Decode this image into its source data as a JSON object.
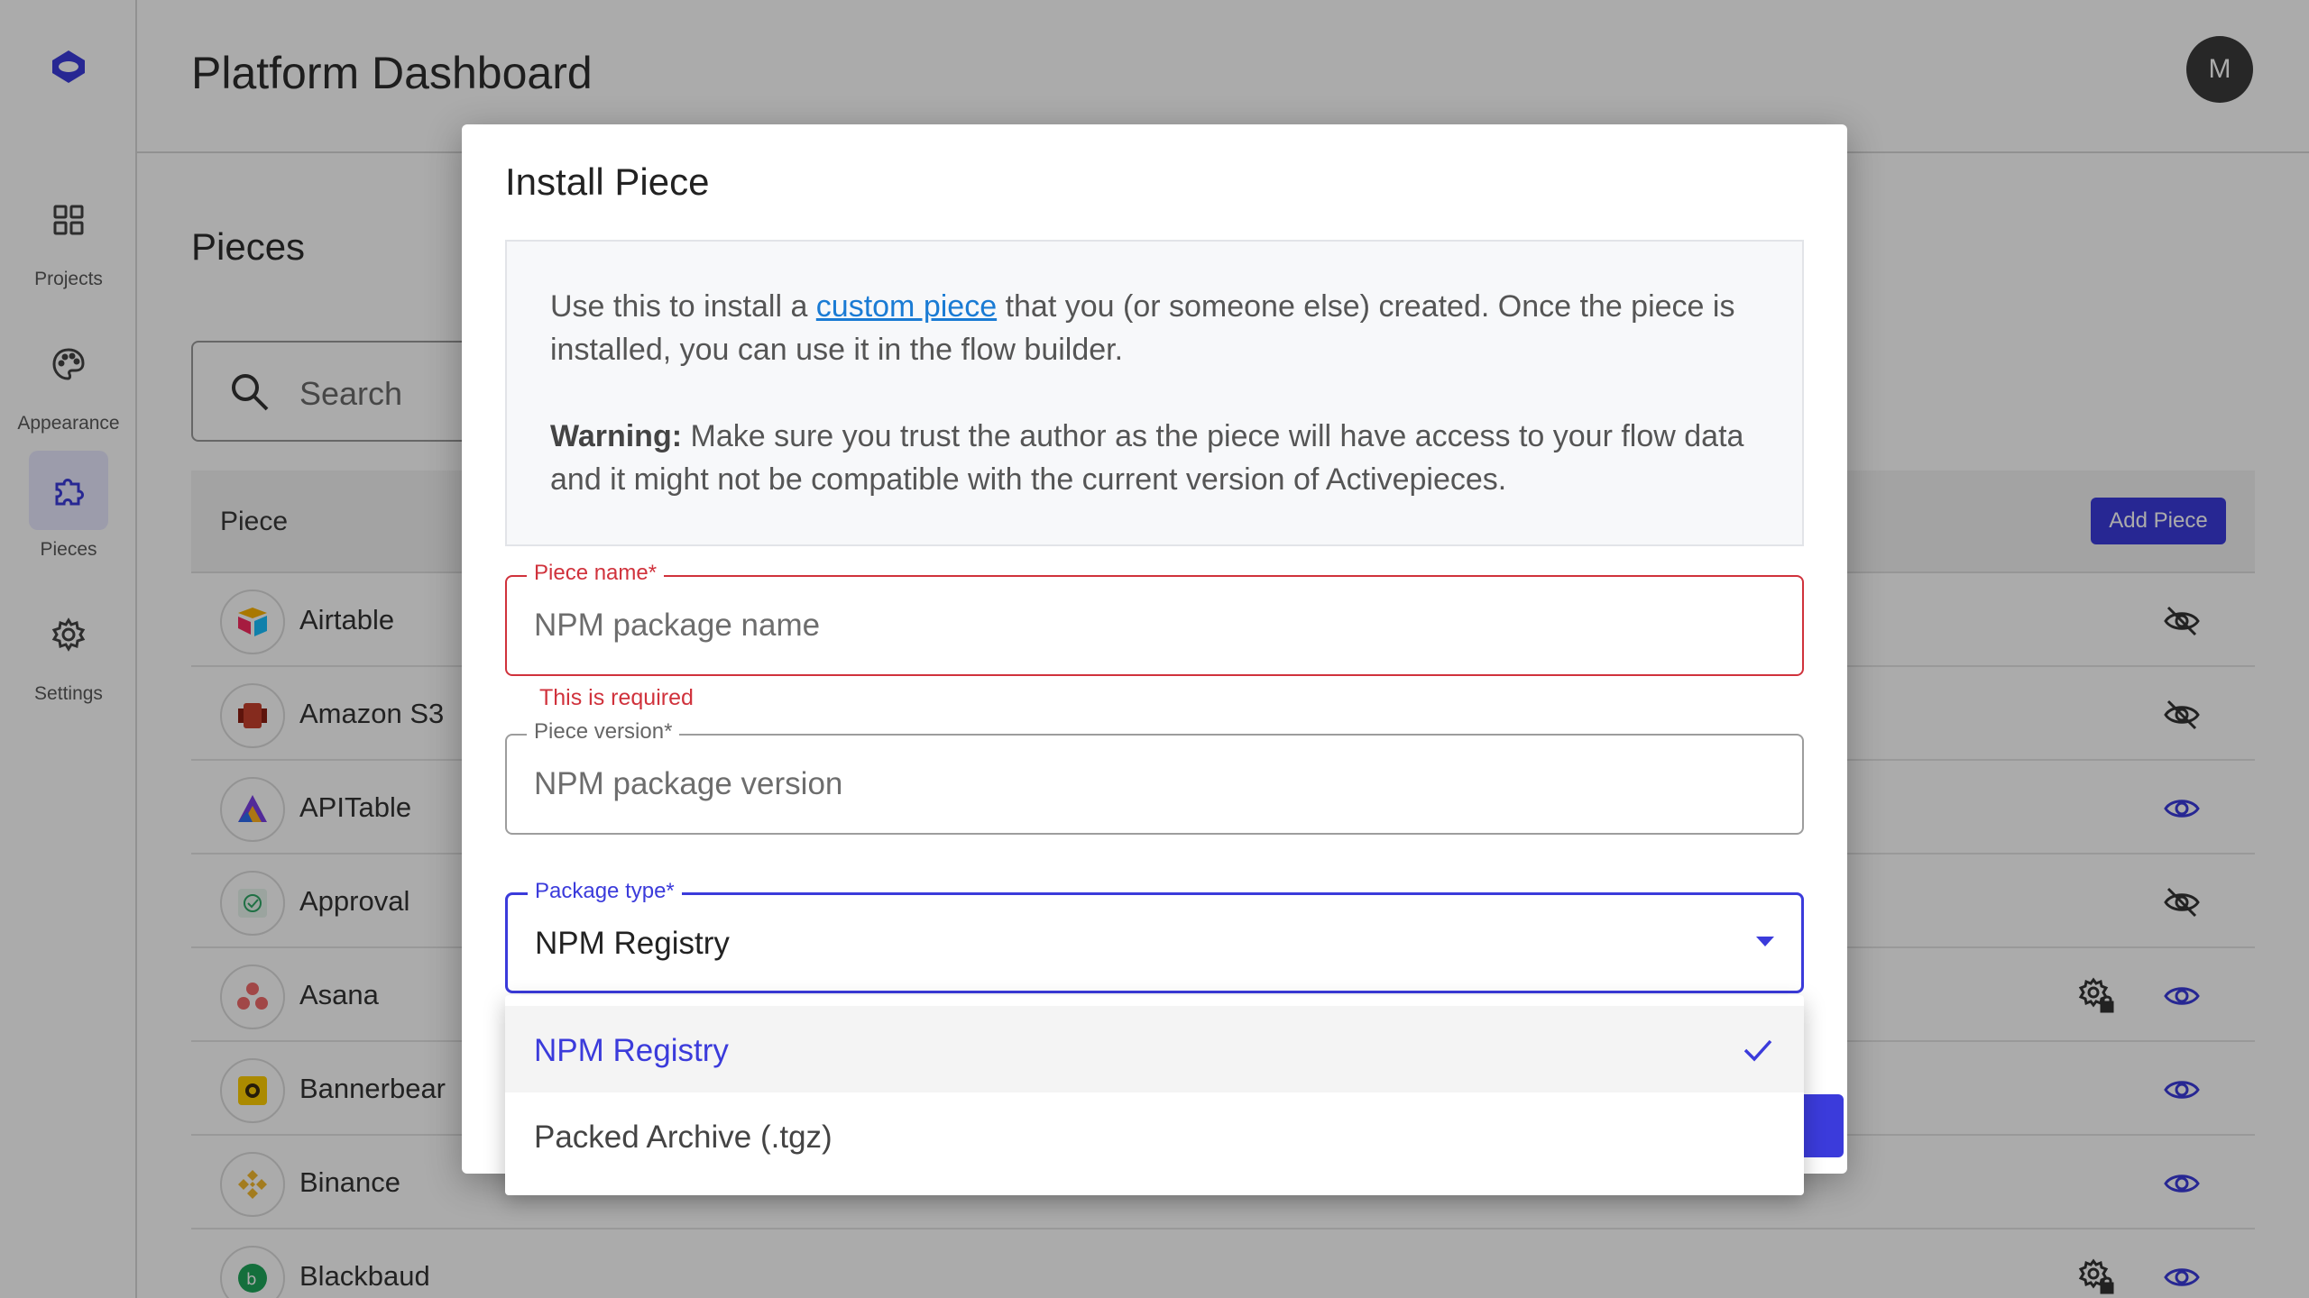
{
  "header": {
    "title": "Platform Dashboard",
    "avatar_initial": "M"
  },
  "sidebar": {
    "items": [
      {
        "label": "Projects",
        "icon": "grid-icon"
      },
      {
        "label": "Appearance",
        "icon": "palette-icon"
      },
      {
        "label": "Pieces",
        "icon": "puzzle-icon",
        "active": true
      },
      {
        "label": "Settings",
        "icon": "gear-icon"
      }
    ]
  },
  "pieces_page": {
    "title": "Pieces",
    "search_placeholder": "Search",
    "column_piece": "Piece",
    "add_button": "Add Piece",
    "rows": [
      {
        "name": "Airtable",
        "visible": false,
        "managed": false
      },
      {
        "name": "Amazon S3",
        "visible": false,
        "managed": false
      },
      {
        "name": "APITable",
        "visible": true,
        "managed": false
      },
      {
        "name": "Approval",
        "visible": false,
        "managed": false
      },
      {
        "name": "Asana",
        "visible": true,
        "managed": true
      },
      {
        "name": "Bannerbear",
        "visible": true,
        "managed": false
      },
      {
        "name": "Binance",
        "visible": true,
        "managed": false
      },
      {
        "name": "Blackbaud",
        "visible": true,
        "managed": true
      }
    ]
  },
  "modal": {
    "title": "Install Piece",
    "info_before_link": "Use this to install a ",
    "info_link": "custom piece",
    "info_after_link": " that you (or someone else) created. Once the piece is installed, you can use it in the flow builder.",
    "warning_label": "Warning:",
    "warning_text": " Make sure you trust the author as the piece will have access to your flow data and it might not be compatible with the current version of Activepieces.",
    "piece_name_label": "Piece name*",
    "piece_name_placeholder": "NPM package name",
    "piece_name_error": "This is required",
    "piece_version_label": "Piece version*",
    "piece_version_placeholder": "NPM package version",
    "package_type_label": "Package type*",
    "package_type_value": "NPM Registry"
  },
  "dropdown": {
    "options": [
      {
        "label": "NPM Registry",
        "selected": true
      },
      {
        "label": "Packed Archive (.tgz)",
        "selected": false
      }
    ]
  },
  "colors": {
    "accent": "#3b3bdb",
    "error": "#d0323c",
    "link": "#1a7bd4"
  }
}
